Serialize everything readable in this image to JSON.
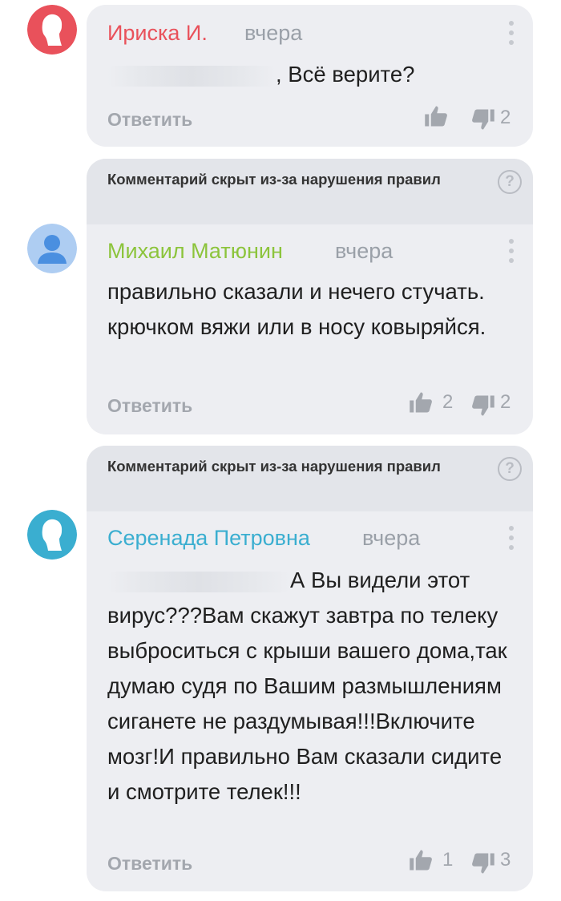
{
  "comments": [
    {
      "author": "Ириска И.",
      "author_color": "#e9515b",
      "avatar_color": "#e9515b",
      "time": "вчера",
      "text": ", Всё верите?",
      "reply_label": "Ответить",
      "likes": "",
      "dislikes": "2"
    },
    {
      "hidden_notice": "Комментарий скрыт из-за нарушения правил",
      "author": "Михаил Матюнин",
      "author_color": "#8cc43c",
      "avatar_color": "#4a8fe0",
      "time": "вчера",
      "text": "правильно сказали и нечего стучать. крючком вяжи или в носу ковыряйся.",
      "reply_label": "Ответить",
      "likes": "2",
      "dislikes": "2"
    },
    {
      "hidden_notice": "Комментарий скрыт из-за нарушения правил",
      "author": "Серенада Петровна",
      "author_color": "#3aaed0",
      "avatar_color": "#3aaed0",
      "time": "вчера",
      "text_first": "А Вы видели этот",
      "text": "вирус???Вам скажут завтра по телеку выброситься с крыши вашего дома,так думаю судя по Вашим размышлениям сиганете не раздумывая!!!Включите мозг!И правильно Вам сказали сидите и смотрите телек!!!",
      "reply_label": "Ответить",
      "likes": "1",
      "dislikes": "3"
    }
  ],
  "icons": [
    "person-silhouette-icon",
    "user-icon",
    "question-icon",
    "more-vertical-icon",
    "thumbs-up-icon",
    "thumbs-down-icon"
  ]
}
